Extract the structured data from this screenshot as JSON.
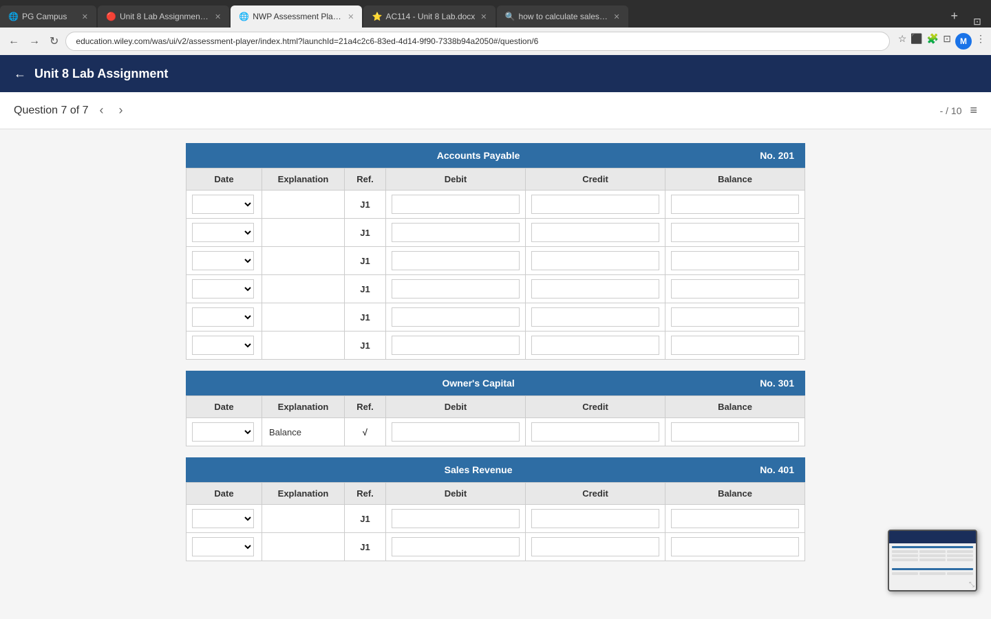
{
  "browser": {
    "tabs": [
      {
        "id": "pg-campus",
        "label": "PG Campus",
        "icon": "🌐",
        "active": false
      },
      {
        "id": "unit8-lab",
        "label": "Unit 8 Lab Assignment - AC11...",
        "icon": "🔴",
        "active": false
      },
      {
        "id": "nwp-assessment",
        "label": "NWP Assessment Player UI Ap...",
        "icon": "🌐",
        "active": true
      },
      {
        "id": "ac114-docx",
        "label": "AC114 - Unit 8 Lab.docx",
        "icon": "⭐",
        "active": false
      },
      {
        "id": "how-to-calculate",
        "label": "how to calculate sales revenue...",
        "icon": "🔍",
        "active": false
      }
    ],
    "address": "education.wiley.com/was/ui/v2/assessment-player/index.html?launchId=21a4c2c6-83ed-4d14-9f90-7338b94a2050#/question/6",
    "profile_initial": "M"
  },
  "app": {
    "title": "Unit 8 Lab Assignment",
    "back_label": "←"
  },
  "question_nav": {
    "label": "Question 7 of 7",
    "prev_arrow": "‹",
    "next_arrow": "›",
    "score": "- / 10"
  },
  "ledgers": [
    {
      "id": "accounts-payable",
      "title": "Accounts Payable",
      "number": "No. 201",
      "columns": [
        "Date",
        "Explanation",
        "Ref.",
        "Debit",
        "Credit",
        "Balance"
      ],
      "rows": [
        {
          "ref": "J1",
          "explanation": ""
        },
        {
          "ref": "J1",
          "explanation": ""
        },
        {
          "ref": "J1",
          "explanation": ""
        },
        {
          "ref": "J1",
          "explanation": ""
        },
        {
          "ref": "J1",
          "explanation": ""
        },
        {
          "ref": "J1",
          "explanation": ""
        }
      ]
    },
    {
      "id": "owners-capital",
      "title": "Owner's Capital",
      "number": "No. 301",
      "columns": [
        "Date",
        "Explanation",
        "Ref.",
        "Debit",
        "Credit",
        "Balance"
      ],
      "rows": [
        {
          "ref": "√",
          "explanation": "Balance"
        }
      ]
    },
    {
      "id": "sales-revenue",
      "title": "Sales Revenue",
      "number": "No. 401",
      "columns": [
        "Date",
        "Explanation",
        "Ref.",
        "Debit",
        "Credit",
        "Balance"
      ],
      "rows": [
        {
          "ref": "J1",
          "explanation": ""
        },
        {
          "ref": "J1",
          "explanation": ""
        }
      ]
    }
  ]
}
